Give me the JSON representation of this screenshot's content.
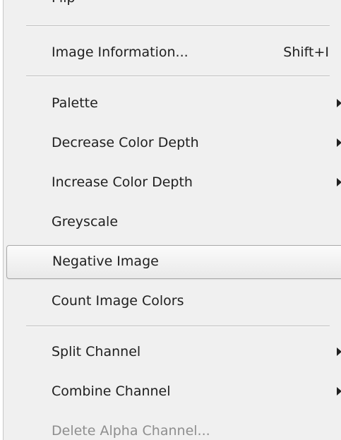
{
  "menu": {
    "partial_top": "Flip",
    "items": [
      {
        "label": "Image Information...",
        "shortcut": "Shift+I"
      },
      {
        "label": "Palette"
      },
      {
        "label": "Decrease Color Depth"
      },
      {
        "label": "Increase Color Depth"
      },
      {
        "label": "Greyscale"
      },
      {
        "label": "Negative Image",
        "highlighted": true
      },
      {
        "label": "Count Image Colors"
      },
      {
        "label": "Split Channel"
      },
      {
        "label": "Combine Channel"
      },
      {
        "label": "Delete Alpha Channel...",
        "disabled": true
      }
    ]
  }
}
